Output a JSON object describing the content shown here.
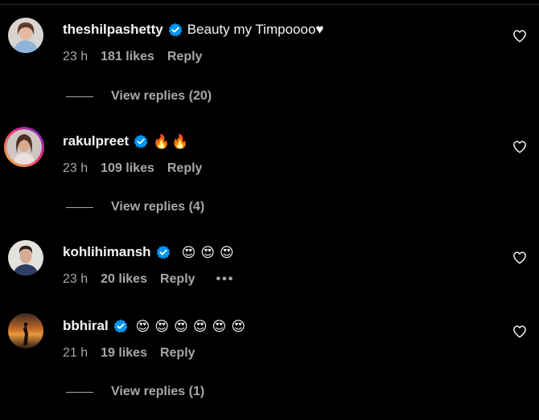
{
  "comments": [
    {
      "username": "theshilpashetty",
      "text": "Beauty my Timpoooo♥",
      "emojis": [],
      "time": "23 h",
      "likes": "181 likes",
      "reply": "Reply",
      "view_replies": "View replies (20)"
    },
    {
      "username": "rakulpreet",
      "text": "",
      "emojis": [
        "🔥",
        "🔥"
      ],
      "time": "23 h",
      "likes": "109 likes",
      "reply": "Reply",
      "view_replies": "View replies (4)"
    },
    {
      "username": "kohlihimansh",
      "text": "",
      "emojis": [
        "😍",
        "😍",
        "😍"
      ],
      "time": "23 h",
      "likes": "20 likes",
      "reply": "Reply",
      "more": "•••",
      "view_replies": ""
    },
    {
      "username": "bbhiral",
      "text": "",
      "emojis": [
        "😍",
        "😍",
        "😍",
        "😍",
        "😍",
        "😍"
      ],
      "time": "21 h",
      "likes": "19 likes",
      "reply": "Reply",
      "view_replies": "View replies (1)"
    }
  ],
  "icons": {
    "verified": "verified-badge-icon",
    "like": "heart-outline-icon"
  },
  "colors": {
    "background": "#000000",
    "primary_text": "#f5f5f5",
    "secondary_text": "#a8a8a8",
    "verified_blue": "#0095f6"
  }
}
